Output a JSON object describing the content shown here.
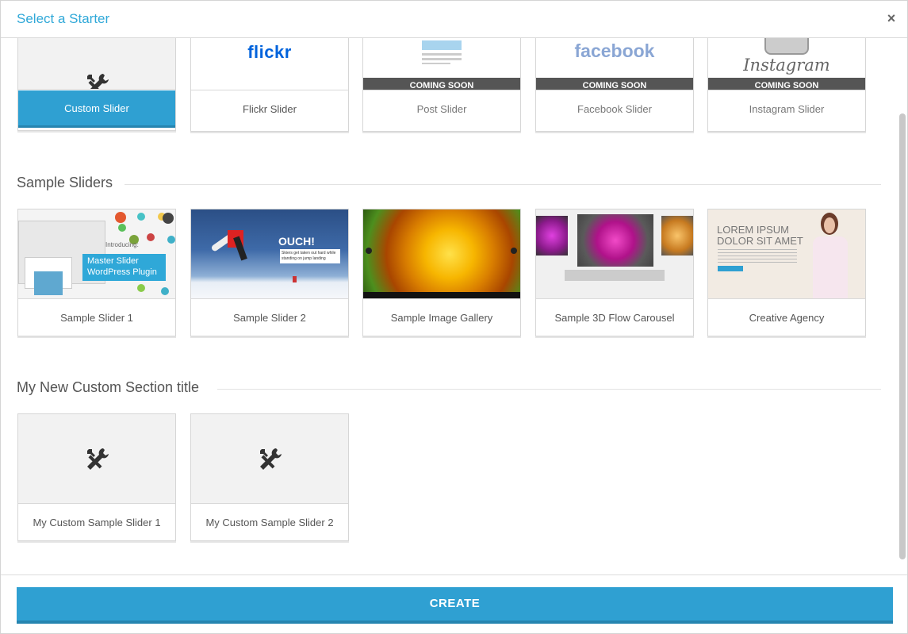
{
  "dialog": {
    "title": "Select a Starter",
    "close_label": "×"
  },
  "starters": [
    {
      "label": "Custom Slider",
      "badge": ""
    },
    {
      "label": "Flickr Slider",
      "brand": "flickr"
    },
    {
      "label": "Post Slider",
      "badge": "COMING SOON"
    },
    {
      "label": "Facebook Slider",
      "badge": "COMING SOON",
      "brand": "facebook"
    },
    {
      "label": "Instagram Slider",
      "badge": "COMING SOON",
      "brand": "Instagram"
    }
  ],
  "sample_section": {
    "title": "Sample Sliders",
    "items": [
      {
        "label": "Sample Slider 1",
        "overlay_line1": "Master Slider",
        "overlay_line2": "WordPress Plugin",
        "small": "Introducing:"
      },
      {
        "label": "Sample Slider 2",
        "headline": "OUCH!",
        "caption": "Skiers get taken out hard while standing on jump landing"
      },
      {
        "label": "Sample Image Gallery"
      },
      {
        "label": "Sample 3D Flow Carousel"
      },
      {
        "label": "Creative Agency",
        "headline_line1": "LOREM IPSUM",
        "headline_line2": "DOLOR SIT AMET"
      }
    ]
  },
  "custom_section": {
    "title": "My New Custom Section title",
    "items": [
      {
        "label": "My Custom Sample Slider 1"
      },
      {
        "label": "My Custom Sample Slider 2"
      }
    ]
  },
  "footer": {
    "create_label": "CREATE"
  },
  "colors": {
    "accent": "#2fa0d2",
    "title": "#2fa8d8",
    "badge_bg": "#555555"
  }
}
